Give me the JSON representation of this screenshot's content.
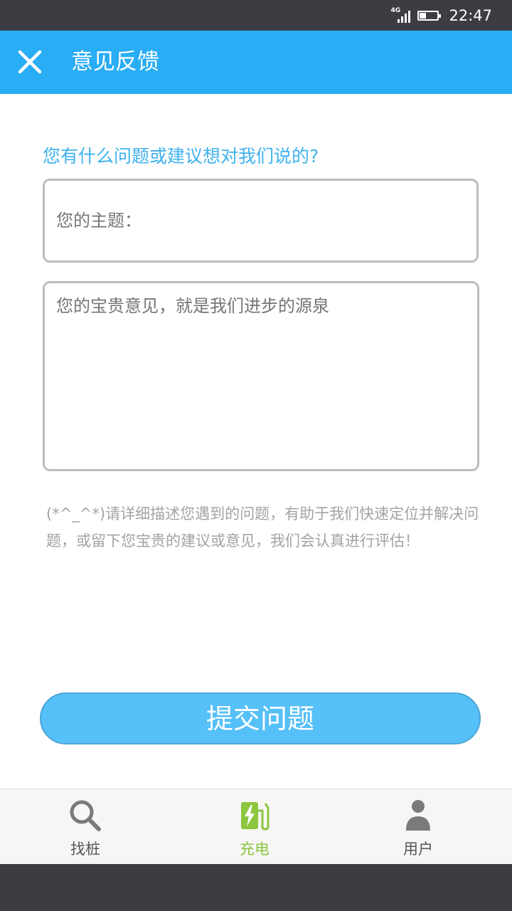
{
  "status_bar": {
    "network": "4G",
    "time": "22:47"
  },
  "toolbar": {
    "title": "意见反馈",
    "close_icon": "close-icon",
    "background_color": "#29adf5"
  },
  "form": {
    "question": "您有什么问题或建议想对我们说的?",
    "subject_placeholder": "您的主题：",
    "opinion_placeholder": "您的宝贵意见，就是我们进步的源泉",
    "hint": "(*^_^*)请详细描述您遇到的问题，有助于我们快速定位并解决问题，或留下您宝贵的建议或意见，我们会认真进行评估！",
    "submit_label": "提交问题"
  },
  "tabbar": {
    "items": [
      {
        "label": "找桩",
        "icon": "search-icon",
        "active": false
      },
      {
        "label": "充电",
        "icon": "charging-icon",
        "active": true
      },
      {
        "label": "用户",
        "icon": "user-icon",
        "active": false
      }
    ],
    "active_color": "#8dc63f"
  }
}
